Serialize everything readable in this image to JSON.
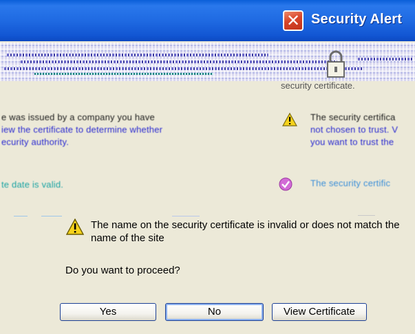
{
  "window": {
    "title": "Security Alert",
    "close_glyph": "✕"
  },
  "certificate": {
    "heading_partial": "security certificate.",
    "left_text_lines": [
      "e was issued by a company you have",
      "iew the certificate to determine whether",
      "ecurity authority."
    ],
    "left_date_line": "te date is valid.",
    "right_warn_lines": [
      "The security certifica",
      "not chosen to trust. V",
      "you want to trust the"
    ],
    "right_valid_line": "The security certific"
  },
  "message": {
    "text": "The name on the security certificate is invalid or does not match the name of the site",
    "question": "Do you want to proceed?"
  },
  "buttons": {
    "yes": "Yes",
    "no": "No",
    "view": "View Certificate"
  },
  "icons": {
    "close": "close-icon",
    "lock": "lock-icon",
    "warning": "warning-icon",
    "check": "check-icon"
  },
  "colors": {
    "titlebar": "#1f6ae2",
    "dialog_bg": "#ece9d8",
    "close_button": "#d8462a",
    "button_border": "#1c3f94",
    "warning": "#f5d21b"
  }
}
